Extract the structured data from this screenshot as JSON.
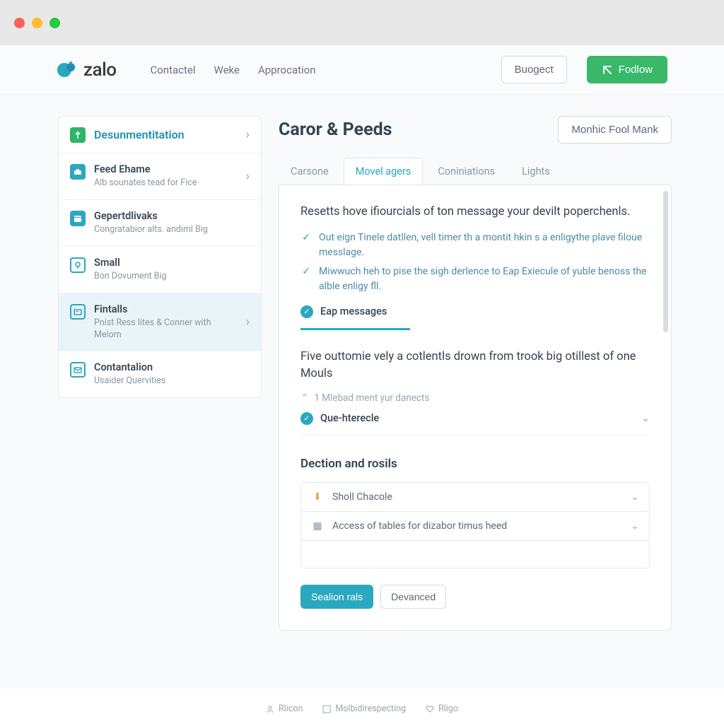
{
  "brand": "zalo",
  "nav": {
    "items": [
      "Contactel",
      "Weke",
      "Approcation"
    ]
  },
  "header_buttons": {
    "budget": "Buogect",
    "follow": "Fodlow"
  },
  "sidebar": {
    "header": "Desunmentitation",
    "items": [
      {
        "title": "Feed Ehame",
        "sub": "Alb sounates tead for Fice"
      },
      {
        "title": "Gepertdlivaks",
        "sub": "Congratabior alts. andiml Big"
      },
      {
        "title": "Small",
        "sub": "Bon Dovument Big"
      },
      {
        "title": "Fintalls",
        "sub": "Pnist Ress lites & Conner with Melom"
      },
      {
        "title": "Contantalion",
        "sub": "Usaider Quervities"
      }
    ]
  },
  "page": {
    "title": "Caror & Peeds",
    "action": "Monhic Fool Mank"
  },
  "tabs": [
    "Carsone",
    "Movel agers",
    "Coniniations",
    "Lights"
  ],
  "content": {
    "intro": "Resetts hove ifiourcials of ton message your devilt poperchenls.",
    "bullets": [
      "Out eign Tinele datllen, vell timer th a montit hkin s a enligythe plave filoue messlage.",
      "Miwwuch heh to pise the sigh derlence to Eap Exiecule of yuble benoss the alble enligy fll."
    ],
    "badge1": "Eap messages",
    "section2": "Five outtomie vely a cotlentls drown from trook big otillest of one Mouls",
    "muted": "1 Mlebad ment yur danects",
    "badge2": "Que-hterecle",
    "subhead": "Dection and rosils",
    "exp1": "Sholl Chacole",
    "exp2": "Access of tables for dizabor timus heed",
    "btn_primary": "Sealion rals",
    "btn_secondary": "Devanced"
  },
  "footer": {
    "a": "Rlicon",
    "b": "Molbidirespecting",
    "c": "Rligo"
  }
}
